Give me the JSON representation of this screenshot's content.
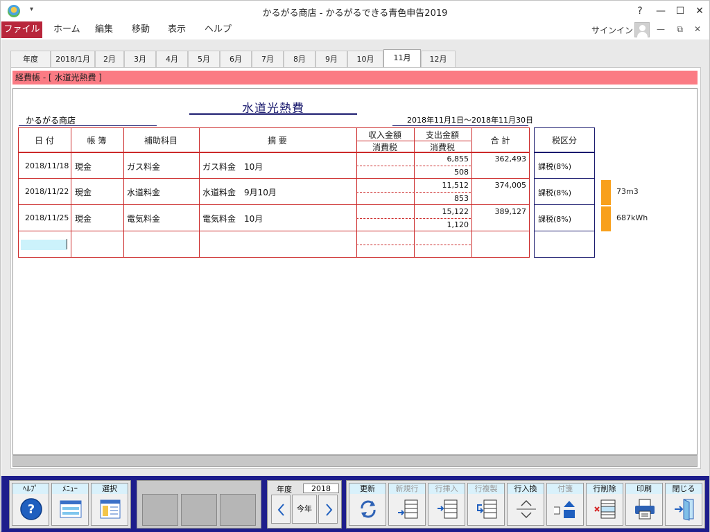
{
  "window": {
    "title": "かるがる商店 - かるがるできる青色申告2019",
    "help": "?",
    "minimize": "—",
    "maximize": "☐",
    "close": "✕",
    "qat": "▾"
  },
  "menu": {
    "items": [
      "ファイル",
      "ホーム",
      "編集",
      "移動",
      "表示",
      "ヘルプ"
    ],
    "signin": "サインイン",
    "mini_min": "—",
    "mini_restore": "⧉",
    "mini_close": "✕"
  },
  "tabs": [
    "年度",
    "2018/1月",
    "2月",
    "3月",
    "4月",
    "5月",
    "6月",
    "7月",
    "8月",
    "9月",
    "10月",
    "11月",
    "12月"
  ],
  "active_tab": "11月",
  "header_bar": "経費帳 - [ 水道光熱費 ]",
  "doc": {
    "title": "水道光熱費",
    "shop": "かるがる商店",
    "period": "2018年11月1日～2018年11月30日"
  },
  "columns": {
    "date": "日 付",
    "book": "帳 簿",
    "sub_account": "補助科目",
    "summary": "摘 要",
    "income": "収入金額",
    "income_tax": "消費税",
    "expense": "支出金額",
    "expense_tax": "消費税",
    "total": "合 計",
    "tax_class": "税区分"
  },
  "rows": [
    {
      "date": "2018/11/18",
      "book": "現金",
      "sub": "ガス料金",
      "summary": "ガス料金　10月",
      "expense": "6,855",
      "expense_tax": "508",
      "total": "362,493",
      "tax": "課税(8%)",
      "note": ""
    },
    {
      "date": "2018/11/22",
      "book": "現金",
      "sub": "水道料金",
      "summary": "水道料金　9月10月",
      "expense": "11,512",
      "expense_tax": "853",
      "total": "374,005",
      "tax": "課税(8%)",
      "note": "73m3"
    },
    {
      "date": "2018/11/25",
      "book": "現金",
      "sub": "電気料金",
      "summary": "電気料金　10月",
      "expense": "15,122",
      "expense_tax": "1,120",
      "total": "389,127",
      "tax": "課税(8%)",
      "note": "687kWh"
    }
  ],
  "toolbar": {
    "help": "ﾍﾙﾌﾟ",
    "menu": "ﾒﾆｭｰ",
    "select": "選択",
    "year_label": "年度",
    "year_value": "2018",
    "this_year": "今年",
    "update": "更新",
    "new_row": "新規行",
    "insert_row": "行挿入",
    "copy_row": "行複製",
    "swap_row": "行入換",
    "sticky": "付箋",
    "delete_row": "行削除",
    "print": "印刷",
    "close": "閉じる"
  },
  "colors": {
    "file_menu": "#b8263b",
    "header_bar": "#fb7b84",
    "grid_red": "#cc2a2a",
    "navy": "#1a1a6e",
    "toolbar_bg": "#1d1d8c",
    "orange": "#f8a01c",
    "cursor": "#ccf2fb"
  }
}
